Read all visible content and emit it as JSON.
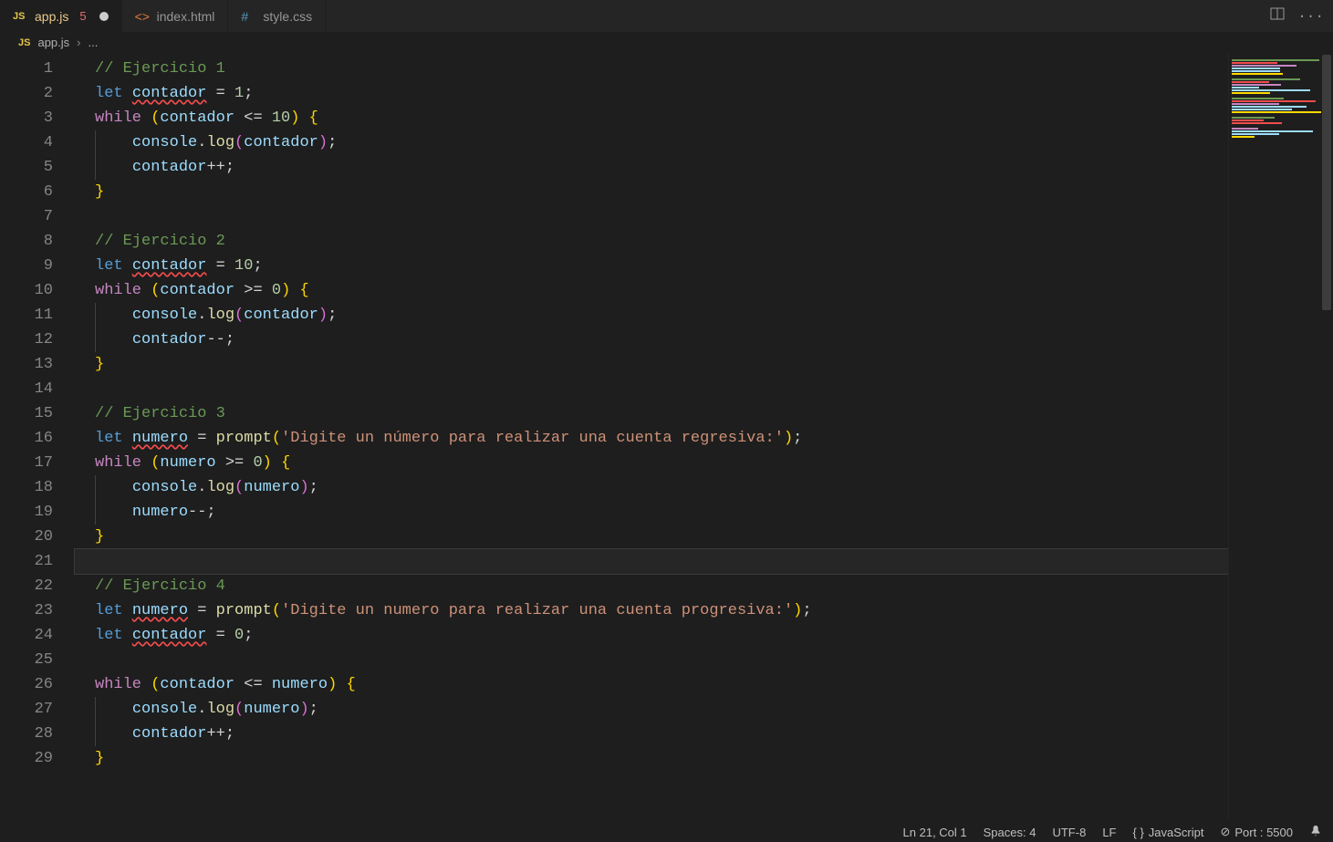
{
  "tabs": [
    {
      "name": "app.js",
      "iconType": "js",
      "active": true,
      "problems": "5",
      "dirty": true
    },
    {
      "name": "index.html",
      "iconType": "html",
      "active": false
    },
    {
      "name": "style.css",
      "iconType": "css",
      "active": false
    }
  ],
  "breadcrumb": {
    "icon": "js",
    "file": "app.js",
    "rest": "..."
  },
  "lines": [
    {
      "n": 1,
      "tokens": [
        [
          "comment",
          "// Ejercicio 1"
        ]
      ]
    },
    {
      "n": 2,
      "tokens": [
        [
          "keyword",
          "let"
        ],
        [
          "punc",
          " "
        ],
        [
          "var squiggle",
          "contador"
        ],
        [
          "punc",
          " = "
        ],
        [
          "num",
          "1"
        ],
        [
          "punc",
          ";"
        ]
      ]
    },
    {
      "n": 3,
      "tokens": [
        [
          "control",
          "while"
        ],
        [
          "punc",
          " "
        ],
        [
          "brace",
          "("
        ],
        [
          "var",
          "contador"
        ],
        [
          "punc",
          " <= "
        ],
        [
          "num",
          "10"
        ],
        [
          "brace",
          ")"
        ],
        [
          "punc",
          " "
        ],
        [
          "brace",
          "{"
        ]
      ]
    },
    {
      "n": 4,
      "indent": 1,
      "tokens": [
        [
          "punc",
          "    "
        ],
        [
          "var",
          "console"
        ],
        [
          "punc",
          "."
        ],
        [
          "func",
          "log"
        ],
        [
          "brace2",
          "("
        ],
        [
          "var",
          "contador"
        ],
        [
          "brace2",
          ")"
        ],
        [
          "punc",
          ";"
        ]
      ]
    },
    {
      "n": 5,
      "indent": 1,
      "tokens": [
        [
          "punc",
          "    "
        ],
        [
          "var",
          "contador"
        ],
        [
          "punc",
          "++;"
        ]
      ]
    },
    {
      "n": 6,
      "tokens": [
        [
          "brace",
          "}"
        ]
      ]
    },
    {
      "n": 7,
      "tokens": []
    },
    {
      "n": 8,
      "tokens": [
        [
          "comment",
          "// Ejercicio 2"
        ]
      ]
    },
    {
      "n": 9,
      "tokens": [
        [
          "keyword",
          "let"
        ],
        [
          "punc",
          " "
        ],
        [
          "var squiggle",
          "contador"
        ],
        [
          "punc",
          " = "
        ],
        [
          "num",
          "10"
        ],
        [
          "punc",
          ";"
        ]
      ]
    },
    {
      "n": 10,
      "tokens": [
        [
          "control",
          "while"
        ],
        [
          "punc",
          " "
        ],
        [
          "brace",
          "("
        ],
        [
          "var",
          "contador"
        ],
        [
          "punc",
          " >= "
        ],
        [
          "num",
          "0"
        ],
        [
          "brace",
          ")"
        ],
        [
          "punc",
          " "
        ],
        [
          "brace",
          "{"
        ]
      ]
    },
    {
      "n": 11,
      "indent": 1,
      "tokens": [
        [
          "punc",
          "    "
        ],
        [
          "var",
          "console"
        ],
        [
          "punc",
          "."
        ],
        [
          "func",
          "log"
        ],
        [
          "brace2",
          "("
        ],
        [
          "var",
          "contador"
        ],
        [
          "brace2",
          ")"
        ],
        [
          "punc",
          ";"
        ]
      ]
    },
    {
      "n": 12,
      "indent": 1,
      "tokens": [
        [
          "punc",
          "    "
        ],
        [
          "var",
          "contador"
        ],
        [
          "punc",
          "--;"
        ]
      ]
    },
    {
      "n": 13,
      "tokens": [
        [
          "brace",
          "}"
        ]
      ]
    },
    {
      "n": 14,
      "tokens": []
    },
    {
      "n": 15,
      "tokens": [
        [
          "comment",
          "// Ejercicio 3"
        ]
      ]
    },
    {
      "n": 16,
      "tokens": [
        [
          "keyword",
          "let"
        ],
        [
          "punc",
          " "
        ],
        [
          "var squiggle",
          "numero"
        ],
        [
          "punc",
          " = "
        ],
        [
          "func",
          "prompt"
        ],
        [
          "brace",
          "("
        ],
        [
          "str",
          "'Digite un número para realizar una cuenta regresiva:'"
        ],
        [
          "brace",
          ")"
        ],
        [
          "punc",
          ";"
        ]
      ]
    },
    {
      "n": 17,
      "tokens": [
        [
          "control",
          "while"
        ],
        [
          "punc",
          " "
        ],
        [
          "brace",
          "("
        ],
        [
          "var",
          "numero"
        ],
        [
          "punc",
          " >= "
        ],
        [
          "num",
          "0"
        ],
        [
          "brace",
          ")"
        ],
        [
          "punc",
          " "
        ],
        [
          "brace",
          "{"
        ]
      ]
    },
    {
      "n": 18,
      "indent": 1,
      "tokens": [
        [
          "punc",
          "    "
        ],
        [
          "var",
          "console"
        ],
        [
          "punc",
          "."
        ],
        [
          "func",
          "log"
        ],
        [
          "brace2",
          "("
        ],
        [
          "var",
          "numero"
        ],
        [
          "brace2",
          ")"
        ],
        [
          "punc",
          ";"
        ]
      ]
    },
    {
      "n": 19,
      "indent": 1,
      "tokens": [
        [
          "punc",
          "    "
        ],
        [
          "var",
          "numero"
        ],
        [
          "punc",
          "--;"
        ]
      ]
    },
    {
      "n": 20,
      "tokens": [
        [
          "brace",
          "}"
        ]
      ]
    },
    {
      "n": 21,
      "current": true,
      "tokens": []
    },
    {
      "n": 22,
      "tokens": [
        [
          "comment",
          "// Ejercicio 4"
        ]
      ]
    },
    {
      "n": 23,
      "tokens": [
        [
          "keyword",
          "let"
        ],
        [
          "punc",
          " "
        ],
        [
          "var squiggle",
          "numero"
        ],
        [
          "punc",
          " = "
        ],
        [
          "func",
          "prompt"
        ],
        [
          "brace",
          "("
        ],
        [
          "str",
          "'Digite un numero para realizar una cuenta progresiva:'"
        ],
        [
          "brace",
          ")"
        ],
        [
          "punc",
          ";"
        ]
      ]
    },
    {
      "n": 24,
      "tokens": [
        [
          "keyword",
          "let"
        ],
        [
          "punc",
          " "
        ],
        [
          "var squiggle",
          "contador"
        ],
        [
          "punc",
          " = "
        ],
        [
          "num",
          "0"
        ],
        [
          "punc",
          ";"
        ]
      ]
    },
    {
      "n": 25,
      "tokens": []
    },
    {
      "n": 26,
      "tokens": [
        [
          "control",
          "while"
        ],
        [
          "punc",
          " "
        ],
        [
          "brace",
          "("
        ],
        [
          "var",
          "contador"
        ],
        [
          "punc",
          " <= "
        ],
        [
          "var",
          "numero"
        ],
        [
          "brace",
          ")"
        ],
        [
          "punc",
          " "
        ],
        [
          "brace",
          "{"
        ]
      ]
    },
    {
      "n": 27,
      "indent": 1,
      "tokens": [
        [
          "punc",
          "    "
        ],
        [
          "var",
          "console"
        ],
        [
          "punc",
          "."
        ],
        [
          "func",
          "log"
        ],
        [
          "brace2",
          "("
        ],
        [
          "var",
          "numero"
        ],
        [
          "brace2",
          ")"
        ],
        [
          "punc",
          ";"
        ]
      ]
    },
    {
      "n": 28,
      "indent": 1,
      "tokens": [
        [
          "punc",
          "    "
        ],
        [
          "var",
          "contador"
        ],
        [
          "punc",
          "++;"
        ]
      ]
    },
    {
      "n": 29,
      "tokens": [
        [
          "brace",
          "}"
        ]
      ]
    }
  ],
  "status": {
    "ln_col": "Ln 21, Col 1",
    "spaces": "Spaces: 4",
    "encoding": "UTF-8",
    "eol": "LF",
    "lang": "JavaScript",
    "port": "Port : 5500"
  },
  "minimap": [
    "#6a9955",
    "#f14c4c",
    "#c586c0",
    "#9cdcfe",
    "#9cdcfe",
    "#ffd700",
    "",
    "#6a9955",
    "#f14c4c",
    "#c586c0",
    "#9cdcfe",
    "#9cdcfe",
    "#ffd700",
    "",
    "#6a9955",
    "#f14c4c",
    "#c586c0",
    "#9cdcfe",
    "#9cdcfe",
    "#ffd700",
    "",
    "#6a9955",
    "#f14c4c",
    "#f14c4c",
    "",
    "#c586c0",
    "#9cdcfe",
    "#9cdcfe",
    "#ffd700",
    "",
    "",
    "",
    "",
    "",
    "",
    "",
    "",
    "",
    "",
    "",
    "",
    "",
    "",
    ""
  ]
}
